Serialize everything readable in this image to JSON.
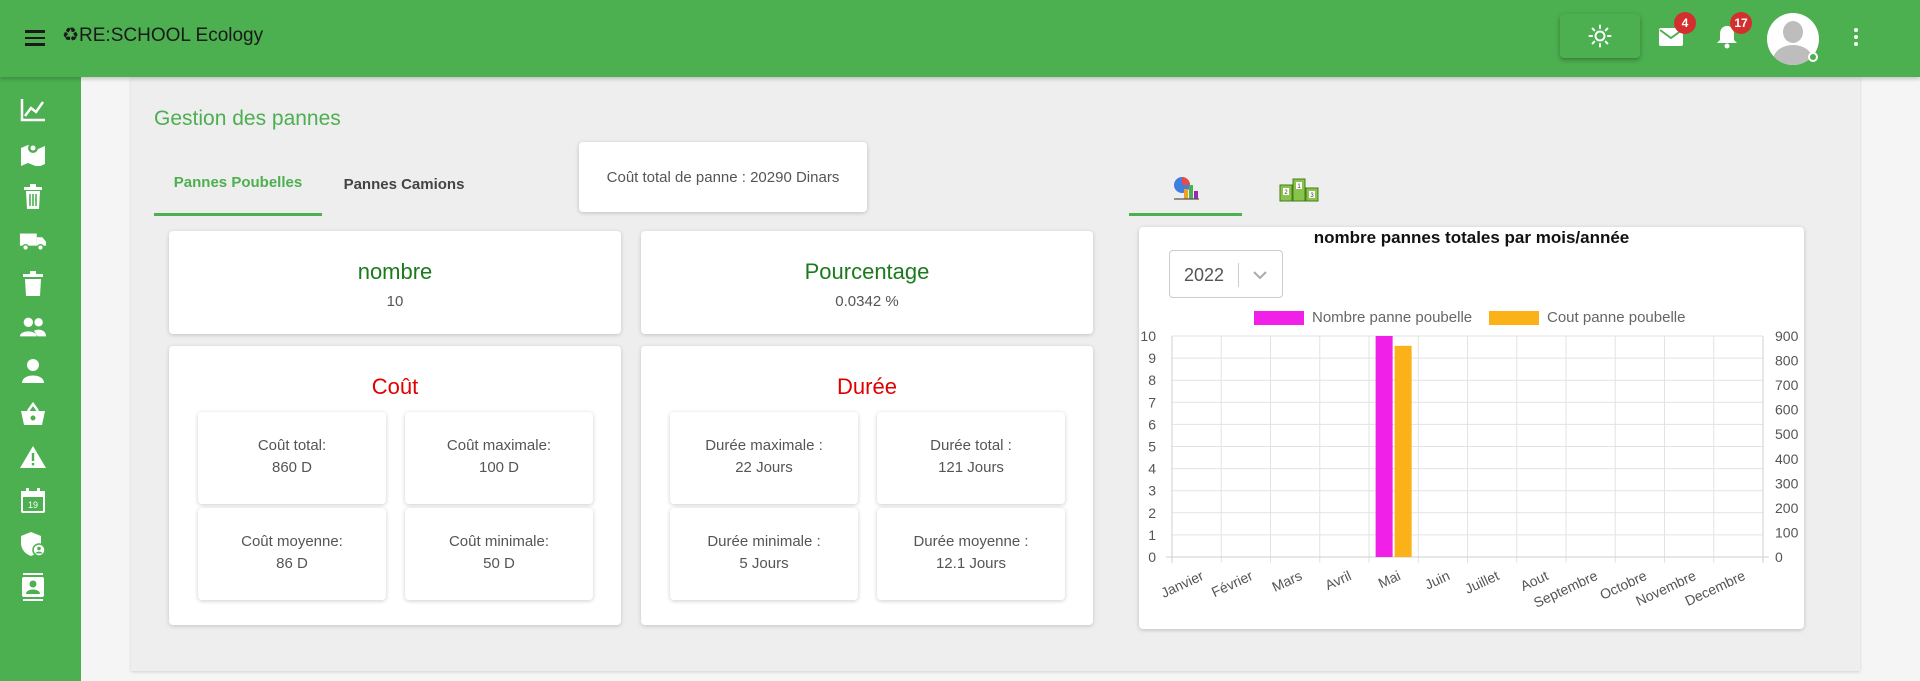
{
  "app": {
    "brand": "♻RE:SCHOOL Ecology"
  },
  "header": {
    "mail_count": "4",
    "notif_count": "17"
  },
  "sidebar": {
    "items": [
      {
        "name": "dashboard-chart-icon"
      },
      {
        "name": "map-icon"
      },
      {
        "name": "bin-icon"
      },
      {
        "name": "truck-icon"
      },
      {
        "name": "trash-icon"
      },
      {
        "name": "group-icon"
      },
      {
        "name": "person-icon"
      },
      {
        "name": "basket-icon"
      },
      {
        "name": "warning-icon"
      },
      {
        "name": "calendar-icon"
      },
      {
        "name": "shield-icon"
      },
      {
        "name": "contact-icon"
      }
    ]
  },
  "page": {
    "title": "Gestion des pannes",
    "tabs": [
      "Pannes Poubelles",
      "Pannes Camions"
    ],
    "total_cost": "Coût total de panne : 20290 Dinars"
  },
  "stats": {
    "nombre": {
      "title": "nombre",
      "value": "10"
    },
    "pourcentage": {
      "title": "Pourcentage",
      "value": "0.0342 %"
    },
    "cout": {
      "title": "Coût",
      "items": [
        {
          "label": "Coût total:",
          "value": "860 D"
        },
        {
          "label": "Coût maximale:",
          "value": "100 D"
        },
        {
          "label": "Coût moyenne:",
          "value": "86 D"
        },
        {
          "label": "Coût minimale:",
          "value": "50 D"
        }
      ]
    },
    "duree": {
      "title": "Durée",
      "items": [
        {
          "label": "Durée maximale :",
          "value": "22 Jours"
        },
        {
          "label": "Durée total :",
          "value": "121 Jours"
        },
        {
          "label": "Durée minimale :",
          "value": "5 Jours"
        },
        {
          "label": "Durée moyenne :",
          "value": "12.1 Jours"
        }
      ]
    }
  },
  "chart_panel": {
    "year": "2022"
  },
  "chart_data": {
    "type": "bar",
    "title": "nombre pannes totales par mois/année",
    "categories": [
      "Janvier",
      "Février",
      "Mars",
      "Avril",
      "Mai",
      "Juin",
      "Juillet",
      "Aout",
      "Septembre",
      "Octobre",
      "Novembre",
      "Decembre"
    ],
    "series": [
      {
        "name": "Nombre panne poubelle",
        "axis": "left",
        "color": "#f020e8",
        "values": [
          0,
          0,
          0,
          0,
          10,
          0,
          0,
          0,
          0,
          0,
          0,
          0
        ]
      },
      {
        "name": "Cout panne poubelle",
        "axis": "right",
        "color": "#fbb118",
        "values": [
          0,
          0,
          0,
          0,
          860,
          0,
          0,
          0,
          0,
          0,
          0,
          0
        ]
      }
    ],
    "ylim_left": [
      0,
      10
    ],
    "ylim_right": [
      0,
      900
    ],
    "yticks_left": [
      "0",
      "1",
      "2",
      "3",
      "4",
      "5",
      "6",
      "7",
      "8",
      "9",
      "10"
    ],
    "yticks_right": [
      "0",
      "100",
      "200",
      "300",
      "400",
      "500",
      "600",
      "700",
      "800",
      "900"
    ],
    "grid": true,
    "legend": "top"
  }
}
